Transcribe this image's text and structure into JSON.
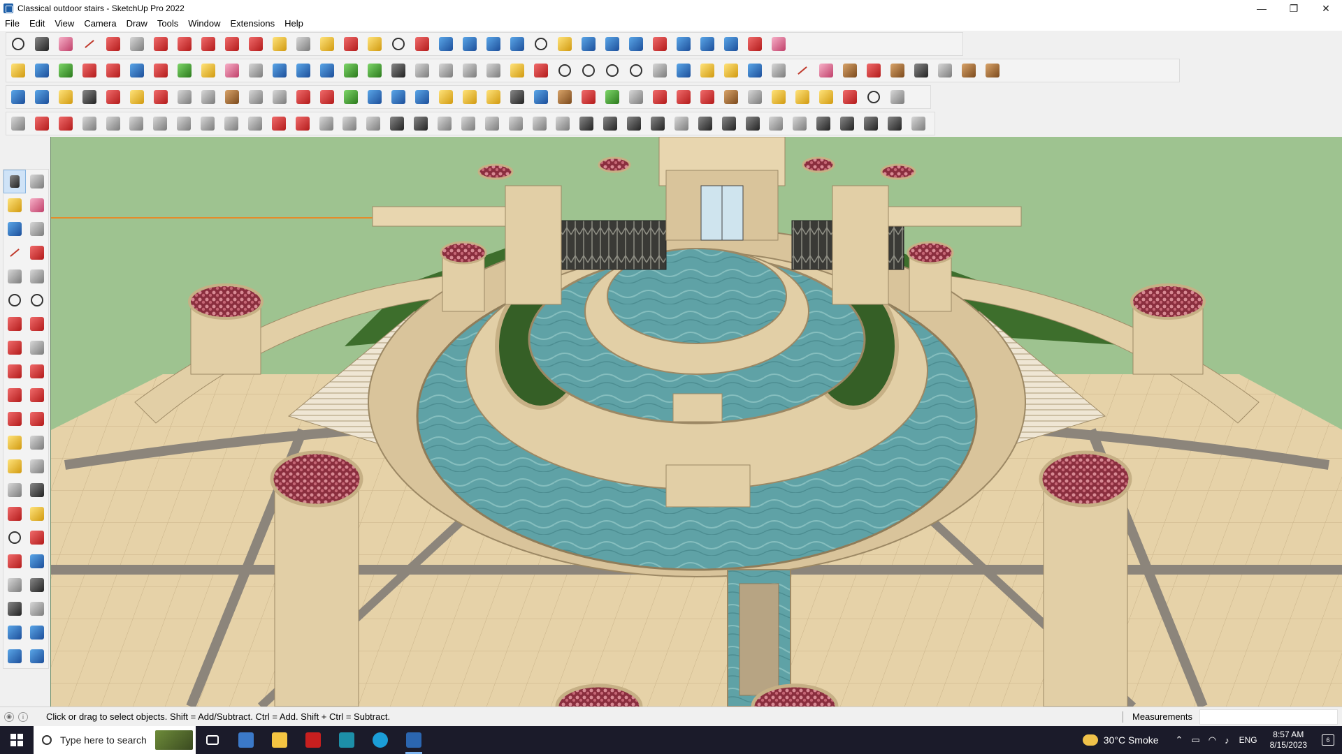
{
  "window": {
    "title": "Classical outdoor stairs - SketchUp Pro 2022",
    "minimize": "—",
    "maximize": "❐",
    "close": "✕"
  },
  "menu": [
    "File",
    "Edit",
    "View",
    "Camera",
    "Draw",
    "Tools",
    "Window",
    "Extensions",
    "Help"
  ],
  "status": {
    "hint": "Click or drag to select objects. Shift = Add/Subtract. Ctrl = Add. Shift + Ctrl = Subtract.",
    "measurements_label": "Measurements",
    "measurements_value": ""
  },
  "taskbar": {
    "search_placeholder": "Type here to search",
    "weather": "30°C  Smoke",
    "language": "ENG",
    "time": "8:57 AM",
    "date": "8/15/2023",
    "notifications": "6"
  },
  "colors": {
    "viewport_bg": "#9ec390",
    "taskbar_bg": "#1b1b2a",
    "stone": "#e2cfa6",
    "water": "#5ea3a8",
    "lawn": "#3d6e2c",
    "flowers": "#b04a5c"
  }
}
